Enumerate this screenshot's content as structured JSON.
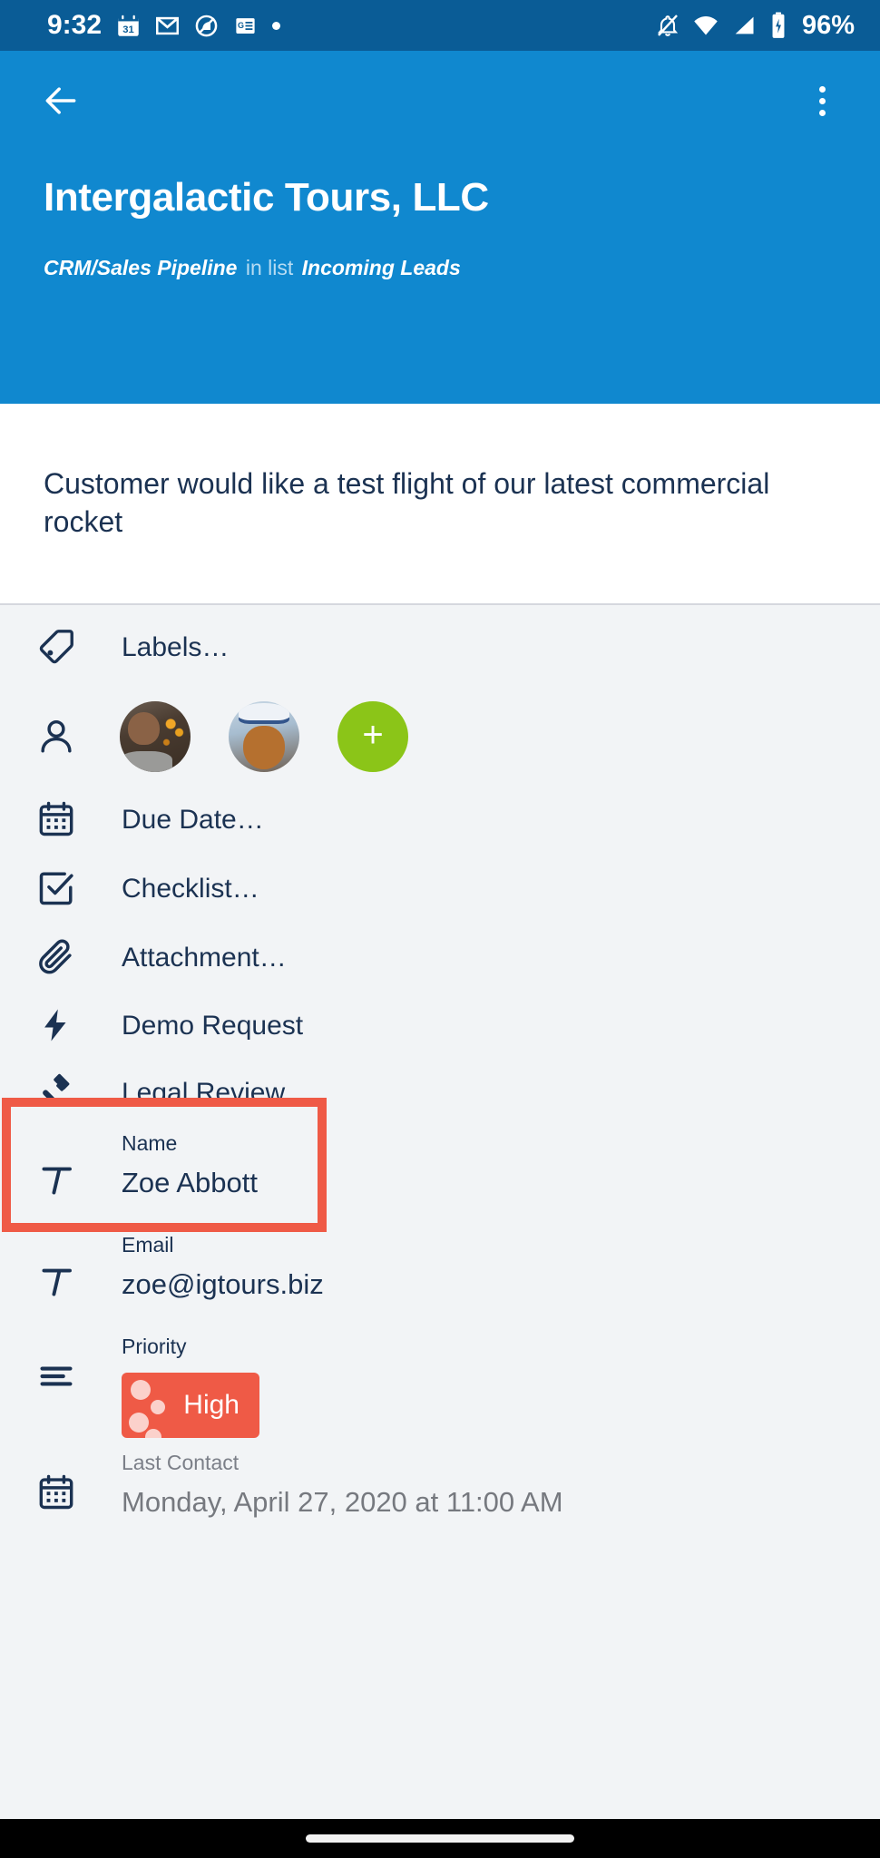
{
  "status_bar": {
    "time": "9:32",
    "battery_percent": "96%",
    "left_icons": [
      "calendar-31-icon",
      "gmail-icon",
      "circle-slash-icon",
      "google-news-icon",
      "dot-icon"
    ],
    "right_icons": [
      "notifications-off-icon",
      "wifi-icon",
      "cell-signal-icon",
      "battery-icon"
    ],
    "background_color": "#0a5c96"
  },
  "app_bar": {
    "back_icon": "back-arrow-icon",
    "overflow_icon": "more-vertical-icon",
    "title": "Intergalactic Tours, LLC",
    "breadcrumb": {
      "board": "CRM/Sales Pipeline",
      "separator": " in list ",
      "list": "Incoming Leads"
    },
    "background_color": "#1088cf"
  },
  "description": {
    "text": "Customer would like a test flight of our latest commercial rocket"
  },
  "details": {
    "labels_row": {
      "icon": "tag-icon",
      "label": "Labels…"
    },
    "members_row": {
      "icon": "person-icon",
      "members": [
        {
          "name": "member-avatar-1"
        },
        {
          "name": "member-avatar-2"
        }
      ],
      "add_label": "+"
    },
    "action_rows": [
      {
        "icon": "calendar-icon",
        "label": "Due Date…"
      },
      {
        "icon": "checklist-icon",
        "label": "Checklist…"
      },
      {
        "icon": "paperclip-icon",
        "label": "Attachment…"
      }
    ],
    "power_up_rows": [
      {
        "icon": "lightning-bolt-icon",
        "label": "Demo Request"
      },
      {
        "icon": "gavel-icon",
        "label": "Legal Review"
      }
    ],
    "custom_fields": [
      {
        "icon": "text-field-icon",
        "label": "Name",
        "value": "Zoe Abbott",
        "type": "text"
      },
      {
        "icon": "text-field-icon",
        "label": "Email",
        "value": "zoe@igtours.biz",
        "type": "text"
      },
      {
        "icon": "list-icon",
        "label": "Priority",
        "value": "High",
        "type": "badge",
        "badge_color": "#ef5a46"
      },
      {
        "icon": "calendar-icon",
        "label": "Last Contact",
        "value": "Monday, April 27, 2020 at 11:00 AM",
        "type": "date"
      }
    ]
  },
  "highlight": {
    "color": "#ef5a46",
    "targets": [
      "Demo Request",
      "Legal Review"
    ]
  },
  "nav_bar": {
    "home_indicator": "home-indicator"
  }
}
